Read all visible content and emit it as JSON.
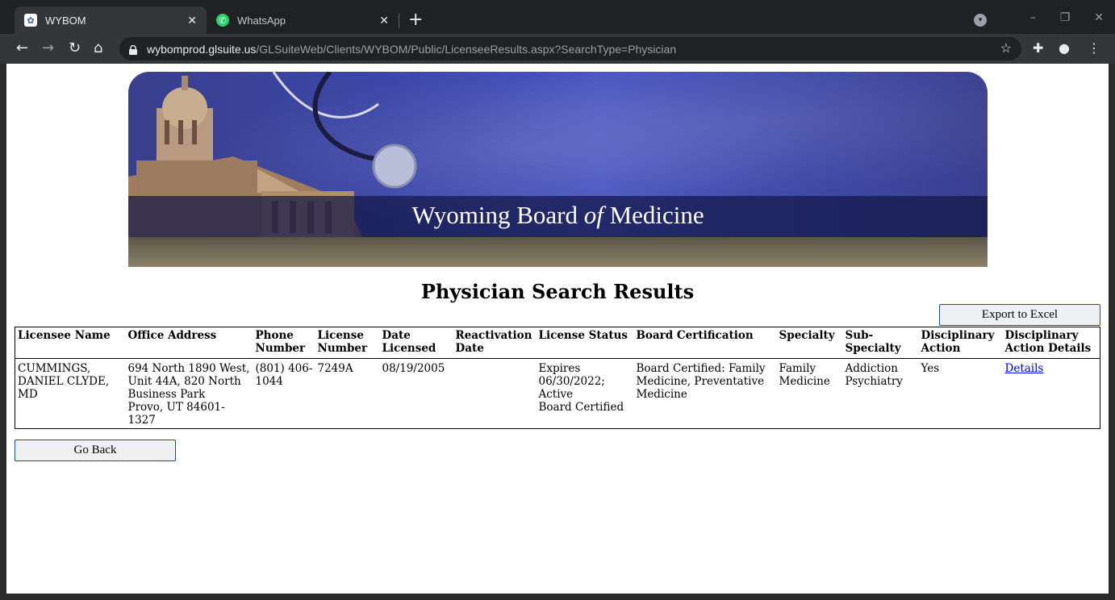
{
  "browser": {
    "tabs": [
      {
        "title": "WYBOM",
        "active": true
      },
      {
        "title": "WhatsApp",
        "active": false
      }
    ],
    "url_host": "wybomprod.glsuite.us",
    "url_path": "/GLSuiteWeb/Clients/WYBOM/Public/LicenseeResults.aspx?SearchType=Physician",
    "icons": [
      "back-icon",
      "forward-icon",
      "reload-icon",
      "home-icon",
      "lock-icon",
      "star-icon",
      "extensions-icon",
      "profile-icon",
      "menu-icon"
    ]
  },
  "banner": {
    "title_pre": "Wyoming Board ",
    "title_italic": "of",
    "title_post": " Medicine",
    "logo_text": "Wyoming"
  },
  "page": {
    "heading": "Physician Search Results",
    "export_label": "Export to Excel",
    "back_label": "Go Back"
  },
  "table": {
    "headers": [
      "Licensee Name",
      "Office Address",
      "Phone Number",
      "License Number",
      "Date Licensed",
      "Reactivation Date",
      "License Status",
      "Board Certification",
      "Specialty",
      "Sub-Specialty",
      "Disciplinary Action",
      "Disciplinary Action Details"
    ],
    "rows": [
      {
        "name": "CUMMINGS, DANIEL CLYDE, MD",
        "address_line1": "694 North 1890 West, Unit 44A, 820 North Business Park",
        "address_line2": "Provo, UT 84601-1327",
        "phone": "(801) 406-1044",
        "license_number": "7249A",
        "date_licensed": "08/19/2005",
        "reactivation_date": "",
        "status_line1": "Expires 06/30/2022; Active",
        "status_line2": "Board Certified",
        "board_certification": "Board Certified: Family Medicine, Preventative Medicine",
        "specialty": "Family Medicine",
        "sub_specialty": "Addiction Psychiatry",
        "disciplinary_action": "Yes",
        "details_link": "Details"
      }
    ]
  }
}
